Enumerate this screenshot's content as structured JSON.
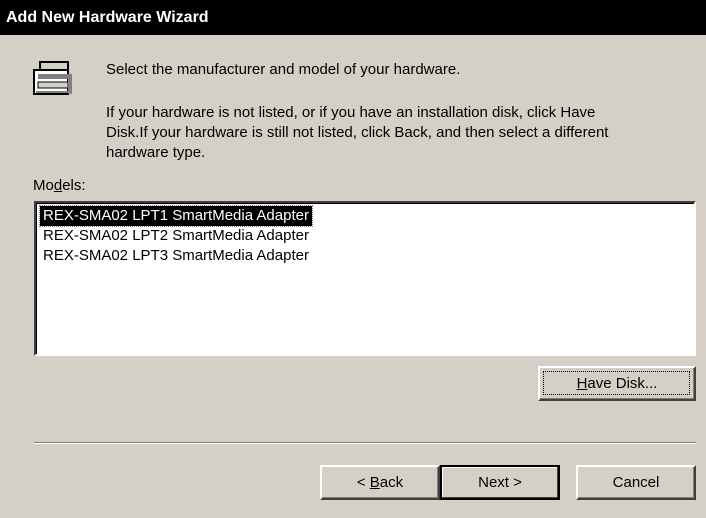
{
  "window": {
    "title": "Add New Hardware Wizard"
  },
  "icons": {
    "header_icon": "hardware-device-icon"
  },
  "header": {
    "instruction": "Select the manufacturer and model of your hardware.",
    "help_line1": "If your hardware is not listed, or if you have an installation disk, click Have",
    "help_line2": "Disk.If your hardware is still not listed, click Back, and then select a different",
    "help_line3": "hardware type."
  },
  "models": {
    "label_prefix": "Mo",
    "label_access_key": "d",
    "label_suffix": "els:",
    "items": [
      {
        "label": "REX-SMA02 LPT1 SmartMedia Adapter",
        "selected": true
      },
      {
        "label": "REX-SMA02 LPT2 SmartMedia Adapter",
        "selected": false
      },
      {
        "label": "REX-SMA02 LPT3 SmartMedia Adapter",
        "selected": false
      }
    ]
  },
  "buttons": {
    "have_disk": {
      "access_key": "H",
      "rest": "ave Disk..."
    },
    "back": {
      "prefix": "< ",
      "access_key": "B",
      "rest": "ack"
    },
    "next": "Next >",
    "cancel": "Cancel"
  }
}
